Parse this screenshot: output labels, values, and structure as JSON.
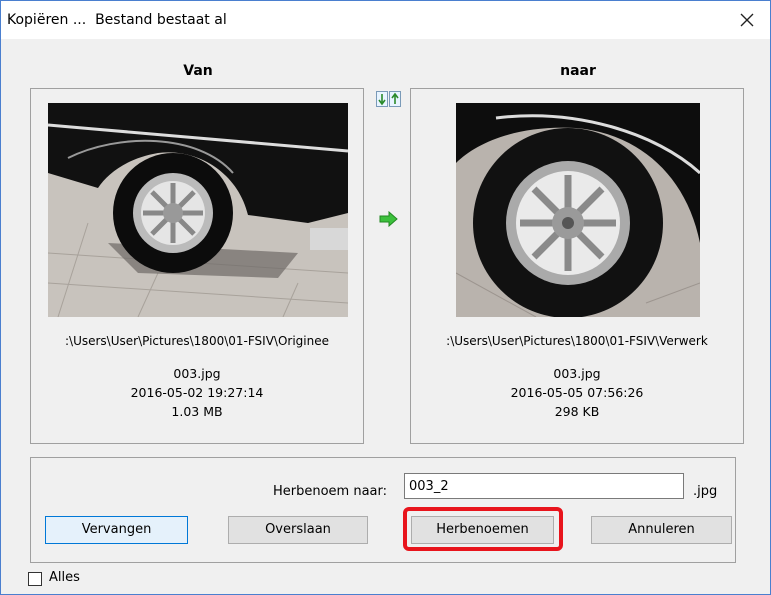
{
  "window": {
    "title": "Kopiëren ...  Bestand bestaat al"
  },
  "source": {
    "header": "Van",
    "path": ":\\Users\\User\\Pictures\\1800\\01-FSIV\\Originee",
    "filename": "003.jpg",
    "date": "2016-05-02 19:27:14",
    "size": "1.03 MB"
  },
  "target": {
    "header": "naar",
    "path": ":\\Users\\User\\Pictures\\1800\\01-FSIV\\Verwerk",
    "filename": "003.jpg",
    "date": "2016-05-05 07:56:26",
    "size": "298 KB"
  },
  "rename": {
    "label": "Herbenoem naar:",
    "value": "003_2",
    "extension": ".jpg"
  },
  "buttons": {
    "replace": "Vervangen",
    "skip": "Overslaan",
    "rename": "Herbenoemen",
    "cancel": "Annuleren"
  },
  "all_checkbox": {
    "label": "Alles",
    "checked": false
  },
  "icons": {
    "swap": "swap-arrows-icon",
    "direction": "right-arrow-icon",
    "close": "close-icon"
  },
  "colors": {
    "highlight": "#e8141c",
    "accent": "#0078d7",
    "arrow": "#22aa22"
  }
}
